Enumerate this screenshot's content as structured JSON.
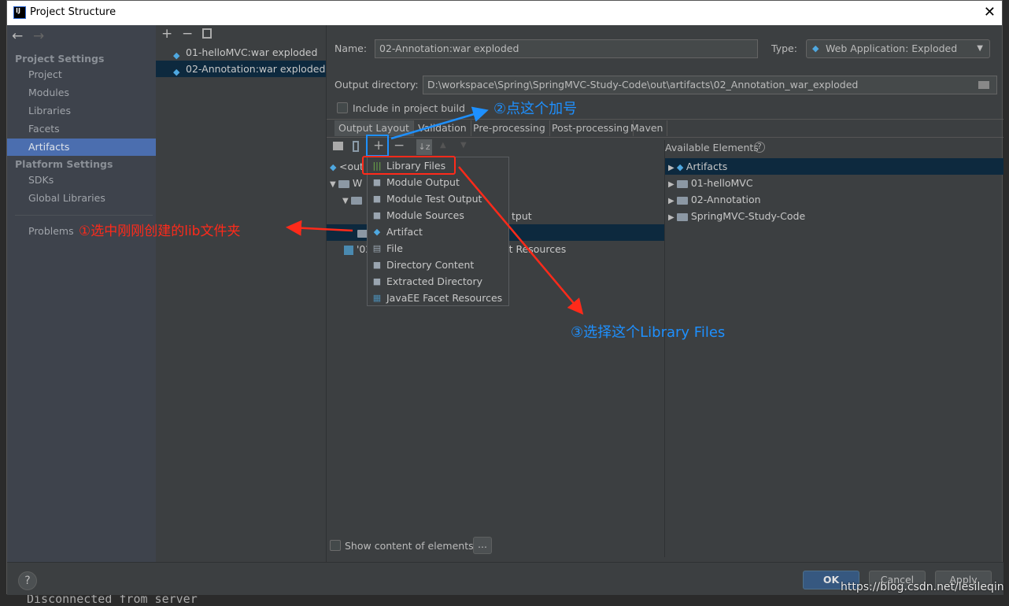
{
  "window": {
    "title": "Project Structure",
    "close_icon": "close-icon"
  },
  "sidebar": {
    "project_settings_header": "Project Settings",
    "project_items": [
      {
        "label": "Project"
      },
      {
        "label": "Modules"
      },
      {
        "label": "Libraries"
      },
      {
        "label": "Facets"
      },
      {
        "label": "Artifacts",
        "selected": true
      }
    ],
    "platform_settings_header": "Platform Settings",
    "platform_items": [
      {
        "label": "SDKs"
      },
      {
        "label": "Global Libraries"
      }
    ],
    "problems": "Problems"
  },
  "artifacts": [
    {
      "label": "01-helloMVC:war exploded"
    },
    {
      "label": "02-Annotation:war exploded",
      "selected": true
    }
  ],
  "form": {
    "name_label": "Name:",
    "name_value": "02-Annotation:war exploded",
    "type_label": "Type:",
    "type_value": "Web Application: Exploded",
    "output_label": "Output directory:",
    "output_value": "D:\\workspace\\Spring\\SpringMVC-Study-Code\\out\\artifacts\\02_Annotation_war_exploded",
    "include_label": "Include in project build",
    "include_checked": false
  },
  "tabs": [
    {
      "label": "Output Layout",
      "selected": true
    },
    {
      "label": "Validation"
    },
    {
      "label": "Pre-processing"
    },
    {
      "label": "Post-processing"
    },
    {
      "label": "Maven"
    }
  ],
  "layout_tree": {
    "row1": "<out",
    "row2": "W",
    "row4": "tput",
    "row6a": "'02",
    "row6b": "cet Resources"
  },
  "popup_items": [
    {
      "label": "Library Files",
      "icon": "library-icon"
    },
    {
      "label": "Module Output",
      "icon": "module-output-icon"
    },
    {
      "label": "Module Test Output",
      "icon": "module-test-output-icon"
    },
    {
      "label": "Module Sources",
      "icon": "module-sources-icon"
    },
    {
      "label": "Artifact",
      "icon": "artifact-icon"
    },
    {
      "label": "File",
      "icon": "file-icon"
    },
    {
      "label": "Directory Content",
      "icon": "directory-icon"
    },
    {
      "label": "Extracted Directory",
      "icon": "extracted-directory-icon"
    },
    {
      "label": "JavaEE Facet Resources",
      "icon": "javaee-icon"
    }
  ],
  "available": {
    "title": "Available Elements",
    "items": [
      {
        "label": "Artifacts",
        "selected": true
      },
      {
        "label": "01-helloMVC"
      },
      {
        "label": "02-Annotation"
      },
      {
        "label": "SpringMVC-Study-Code"
      }
    ]
  },
  "show_content_label": "Show content of elements",
  "ellipsis": "...",
  "buttons": {
    "help": "?",
    "ok": "OK",
    "cancel": "Cancel",
    "apply": "Apply"
  },
  "annotations": {
    "step1": "①选中刚刚创建的lib文件夹",
    "step2": "②点这个加号",
    "step3": "③选择这个Library Files",
    "red": "#ff2a1a",
    "blue": "#1e90ff"
  },
  "background_text": "Disconnected from server",
  "watermark": "https://blog.csdn.net/lesileqin"
}
